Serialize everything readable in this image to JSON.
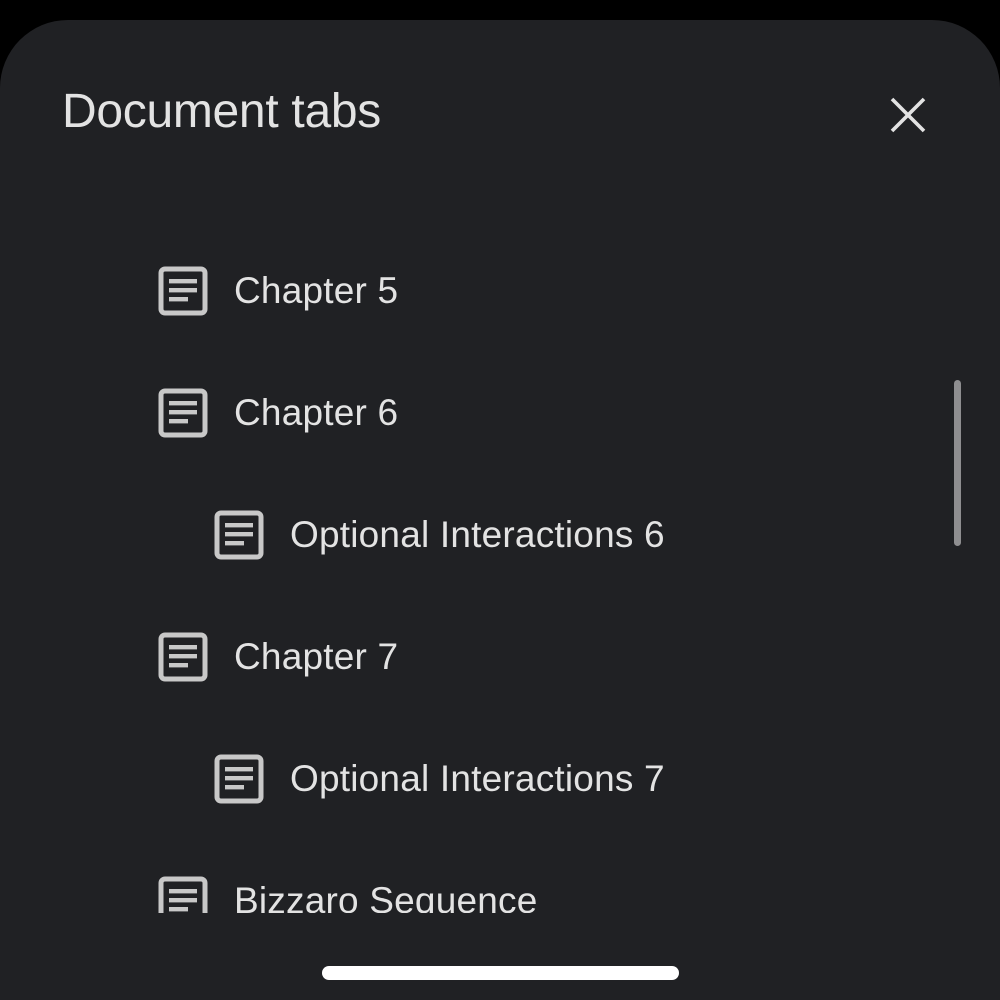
{
  "sheet": {
    "title": "Document tabs",
    "close_icon": "close-icon"
  },
  "tabs": [
    {
      "label": "Chapter 5",
      "level": 0,
      "icon": "document-icon"
    },
    {
      "label": "Chapter 6",
      "level": 0,
      "icon": "document-icon"
    },
    {
      "label": "Optional Interactions 6",
      "level": 1,
      "icon": "document-icon"
    },
    {
      "label": "Chapter 7",
      "level": 0,
      "icon": "document-icon"
    },
    {
      "label": "Optional Interactions 7",
      "level": 1,
      "icon": "document-icon"
    },
    {
      "label": "Bizzaro Sequence",
      "level": 0,
      "icon": "document-icon"
    }
  ],
  "colors": {
    "sheet_background": "#202124",
    "text": "#e3e3e3",
    "icon": "#c8c8c8",
    "scrollbar": "#8e8e90",
    "home_indicator": "#ffffff"
  }
}
